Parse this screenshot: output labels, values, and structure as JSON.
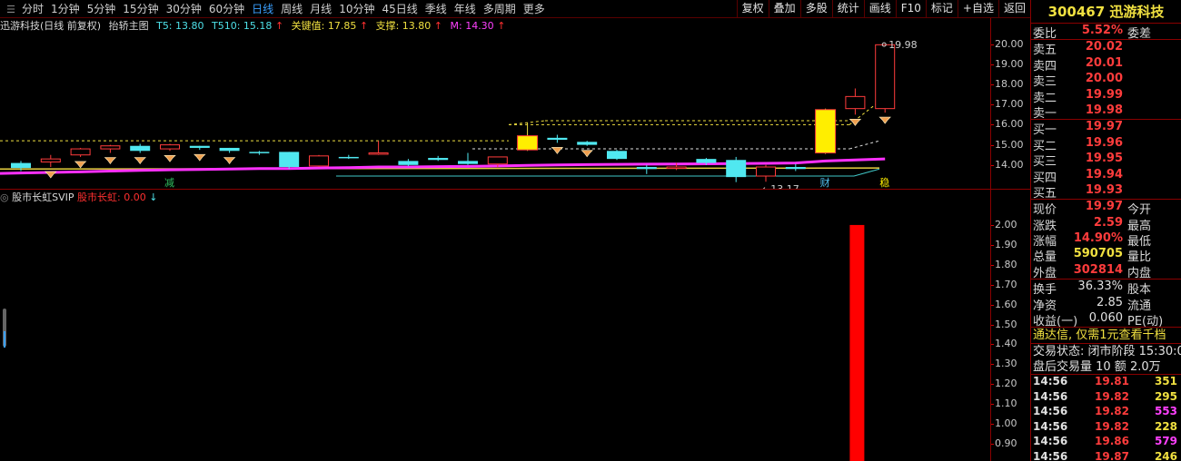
{
  "toolbar": {
    "periods": [
      {
        "label": "分时",
        "active": false
      },
      {
        "label": "1分钟",
        "active": false
      },
      {
        "label": "5分钟",
        "active": false
      },
      {
        "label": "15分钟",
        "active": false
      },
      {
        "label": "30分钟",
        "active": false
      },
      {
        "label": "60分钟",
        "active": false
      },
      {
        "label": "日线",
        "active": true
      },
      {
        "label": "周线",
        "active": false
      },
      {
        "label": "月线",
        "active": false
      },
      {
        "label": "10分钟",
        "active": false
      },
      {
        "label": "45日线",
        "active": false
      },
      {
        "label": "季线",
        "active": false
      },
      {
        "label": "年线",
        "active": false
      },
      {
        "label": "多周期",
        "active": false
      },
      {
        "label": "更多",
        "active": false
      }
    ],
    "buttons": [
      "复权",
      "叠加",
      "多股",
      "统计",
      "画线",
      "F10",
      "标记",
      "+自选",
      "返回"
    ]
  },
  "chart_title": {
    "stock": "迅游科技(日线 前复权)",
    "formula": "抬轿主图",
    "t5": "T5: 13.80",
    "t510": "T510: 15.18",
    "key": "关键值: 17.85",
    "support": "支撑: 13.80",
    "m": "M: 14.30",
    "up_arrow": "↑"
  },
  "sub_title": {
    "name": "股市长虹SVIP",
    "value": "股市长虹: 0.00",
    "arrow": "↓"
  },
  "price_axis": [
    "20.00",
    "19.00",
    "18.00",
    "17.00",
    "16.00",
    "15.00",
    "14.00"
  ],
  "sub_axis": [
    "2.00",
    "1.90",
    "1.80",
    "1.70",
    "1.60",
    "1.50",
    "1.40",
    "1.30",
    "1.20",
    "1.10",
    "1.00",
    "0.90"
  ],
  "chart_labels": {
    "high": "19.98",
    "low": "←13.17",
    "mark_jian": "减",
    "mark_cai": "财",
    "mark_last": "稳"
  },
  "quote": {
    "code": "300467",
    "name": "迅游科技",
    "weibi_label": "委比",
    "weibi": "5.52%",
    "weicha_label": "委差",
    "asks": [
      {
        "label": "卖五",
        "price": "20.02"
      },
      {
        "label": "卖四",
        "price": "20.01"
      },
      {
        "label": "卖三",
        "price": "20.00"
      },
      {
        "label": "卖二",
        "price": "19.99"
      },
      {
        "label": "卖一",
        "price": "19.98"
      }
    ],
    "bids": [
      {
        "label": "买一",
        "price": "19.97"
      },
      {
        "label": "买二",
        "price": "19.96"
      },
      {
        "label": "买三",
        "price": "19.95"
      },
      {
        "label": "买四",
        "price": "19.94"
      },
      {
        "label": "买五",
        "price": "19.93"
      }
    ],
    "stats": [
      {
        "l": "现价",
        "v": "19.97",
        "r": "今开",
        "color": "red"
      },
      {
        "l": "涨跌",
        "v": "2.59",
        "r": "最高",
        "color": "red"
      },
      {
        "l": "涨幅",
        "v": "14.90%",
        "r": "最低",
        "color": "red"
      },
      {
        "l": "总量",
        "v": "590705",
        "r": "量比",
        "color": "yel"
      },
      {
        "l": "外盘",
        "v": "302814",
        "r": "内盘",
        "color": "red"
      }
    ],
    "stats2": [
      {
        "l": "换手",
        "v": "36.33%",
        "r": "股本"
      },
      {
        "l": "净资",
        "v": "2.85",
        "r": "流通"
      },
      {
        "l": "收益(一)",
        "v": "0.060",
        "r": "PE(动)"
      }
    ],
    "ad": "通达信, 仅需1元查看千档",
    "trade_status": "交易状态: 闭市阶段 15:30:0",
    "after_hours": "盘后交易量 10 额 2.0万",
    "ticks": [
      {
        "t": "14:56",
        "p": "19.81",
        "q": "351",
        "qc": "#f0e040"
      },
      {
        "t": "14:56",
        "p": "19.82",
        "q": "295",
        "qc": "#f0e040"
      },
      {
        "t": "14:56",
        "p": "19.82",
        "q": "553",
        "qc": "#ff40ff"
      },
      {
        "t": "14:56",
        "p": "19.82",
        "q": "228",
        "qc": "#f0e040"
      },
      {
        "t": "14:56",
        "p": "19.86",
        "q": "579",
        "qc": "#ff40ff"
      },
      {
        "t": "14:56",
        "p": "19.87",
        "q": "246",
        "qc": "#f0e040"
      }
    ]
  },
  "chart_data": {
    "type": "candlestick",
    "ylim": [
      13.0,
      20.3
    ],
    "candles": [
      {
        "o": 14.1,
        "h": 14.2,
        "l": 13.7,
        "c": 13.85
      },
      {
        "o": 14.15,
        "h": 14.5,
        "l": 13.9,
        "c": 14.3
      },
      {
        "o": 14.5,
        "h": 14.85,
        "l": 14.4,
        "c": 14.8
      },
      {
        "o": 14.8,
        "h": 15.0,
        "l": 14.6,
        "c": 14.95
      },
      {
        "o": 14.95,
        "h": 15.05,
        "l": 14.6,
        "c": 14.7
      },
      {
        "o": 14.8,
        "h": 15.05,
        "l": 14.7,
        "c": 15.0
      },
      {
        "o": 14.95,
        "h": 14.95,
        "l": 14.75,
        "c": 14.85
      },
      {
        "o": 14.85,
        "h": 14.85,
        "l": 14.6,
        "c": 14.7
      },
      {
        "o": 14.65,
        "h": 14.7,
        "l": 14.5,
        "c": 14.6
      },
      {
        "o": 14.65,
        "h": 14.65,
        "l": 13.8,
        "c": 13.9
      },
      {
        "o": 13.95,
        "h": 14.5,
        "l": 13.9,
        "c": 14.45
      },
      {
        "o": 14.4,
        "h": 14.5,
        "l": 14.3,
        "c": 14.35
      },
      {
        "o": 14.55,
        "h": 15.2,
        "l": 14.5,
        "c": 14.6
      },
      {
        "o": 14.2,
        "h": 14.3,
        "l": 13.95,
        "c": 14.0
      },
      {
        "o": 14.35,
        "h": 14.45,
        "l": 14.2,
        "c": 14.25
      },
      {
        "o": 14.2,
        "h": 14.6,
        "l": 14.0,
        "c": 14.05
      },
      {
        "o": 14.05,
        "h": 14.4,
        "l": 13.9,
        "c": 14.4
      },
      {
        "o": 14.75,
        "h": 16.1,
        "l": 14.7,
        "c": 15.45
      },
      {
        "o": 15.35,
        "h": 15.5,
        "l": 15.1,
        "c": 15.25
      },
      {
        "o": 15.15,
        "h": 15.2,
        "l": 14.95,
        "c": 15.0
      },
      {
        "o": 14.7,
        "h": 14.75,
        "l": 14.25,
        "c": 14.3
      },
      {
        "o": 13.9,
        "h": 14.0,
        "l": 13.55,
        "c": 13.8
      },
      {
        "o": 13.85,
        "h": 14.1,
        "l": 13.75,
        "c": 13.9
      },
      {
        "o": 14.3,
        "h": 14.35,
        "l": 14.0,
        "c": 14.1
      },
      {
        "o": 14.25,
        "h": 14.4,
        "l": 13.15,
        "c": 13.4
      },
      {
        "o": 13.45,
        "h": 14.0,
        "l": 13.17,
        "c": 13.9
      },
      {
        "o": 13.9,
        "h": 14.05,
        "l": 13.7,
        "c": 13.8
      },
      {
        "o": 14.6,
        "h": 16.8,
        "l": 14.55,
        "c": 16.75
      },
      {
        "o": 16.8,
        "h": 17.8,
        "l": 16.5,
        "c": 17.4
      },
      {
        "o": 16.8,
        "h": 19.98,
        "l": 16.6,
        "c": 19.97
      }
    ],
    "diamond_days": [
      1,
      2,
      3,
      4,
      5,
      6,
      7,
      18,
      19,
      28,
      29
    ],
    "lines": {
      "magenta_ma": [
        13.6,
        13.63,
        13.66,
        13.7,
        13.73,
        13.76,
        13.78,
        13.8,
        13.82,
        13.82,
        13.85,
        13.87,
        13.9,
        13.9,
        13.92,
        13.93,
        13.95,
        13.98,
        14.0,
        14.02,
        14.03,
        14.04,
        14.05,
        14.06,
        14.07,
        14.08,
        14.1,
        14.2,
        14.25,
        14.3
      ],
      "key_level": 15.2,
      "resistance": 16.0,
      "support": 13.8
    },
    "sub_bar": {
      "index": 28,
      "value": 2.0
    },
    "sub_ylim": [
      0.85,
      2.1
    ]
  }
}
